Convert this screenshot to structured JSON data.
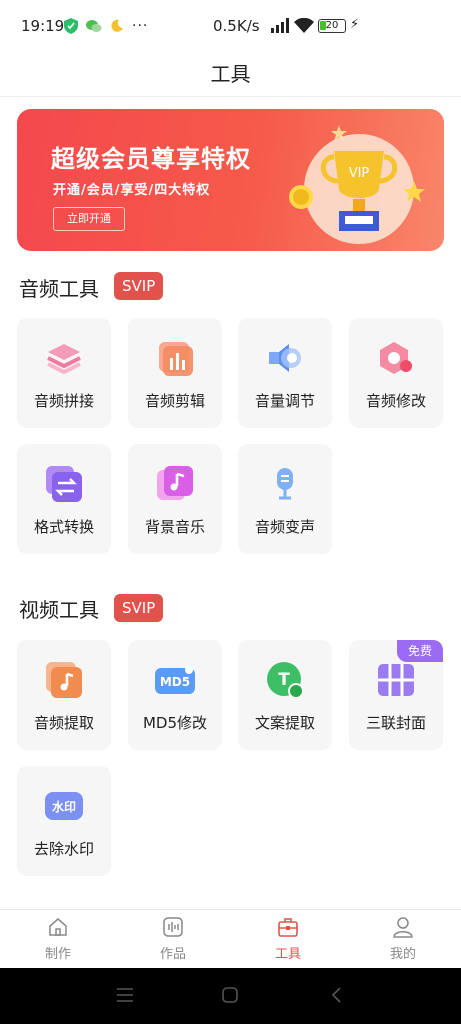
{
  "status": {
    "time": "19:19",
    "speed": "0.5K/s",
    "battery": "20"
  },
  "header": {
    "title": "工具"
  },
  "banner": {
    "title": "超级会员尊享特权",
    "subtitle": "开通/会员/享受/四大特权",
    "button": "立即开通",
    "trophy_text": "VIP"
  },
  "audio_section": {
    "title": "音频工具",
    "badge": "SVIP",
    "items": [
      {
        "label": "音频拼接",
        "icon": "layers-icon"
      },
      {
        "label": "音频剪辑",
        "icon": "bars-icon"
      },
      {
        "label": "音量调节",
        "icon": "speaker-icon"
      },
      {
        "label": "音频修改",
        "icon": "hexagon-icon"
      },
      {
        "label": "格式转换",
        "icon": "swap-icon"
      },
      {
        "label": "背景音乐",
        "icon": "music-note-icon"
      },
      {
        "label": "音频变声",
        "icon": "microphone-icon"
      }
    ]
  },
  "video_section": {
    "title": "视频工具",
    "badge": "SVIP",
    "items": [
      {
        "label": "音频提取",
        "icon": "music-note-icon"
      },
      {
        "label": "MD5修改",
        "icon": "md5-icon",
        "icon_text": "MD5"
      },
      {
        "label": "文案提取",
        "icon": "text-icon",
        "icon_text": "T"
      },
      {
        "label": "三联封面",
        "icon": "grid-icon",
        "badge": "免费"
      },
      {
        "label": "去除水印",
        "icon": "watermark-icon",
        "icon_text": "水印"
      }
    ]
  },
  "tabbar": {
    "items": [
      {
        "label": "制作",
        "icon": "home-icon"
      },
      {
        "label": "作品",
        "icon": "works-icon"
      },
      {
        "label": "工具",
        "icon": "toolbox-icon",
        "active": true
      },
      {
        "label": "我的",
        "icon": "user-icon"
      }
    ]
  },
  "colors": {
    "accent": "#e2524d",
    "svip": "#e2524d",
    "free_badge": "#9b6cf2",
    "tile_bg": "#f6f6f6"
  }
}
